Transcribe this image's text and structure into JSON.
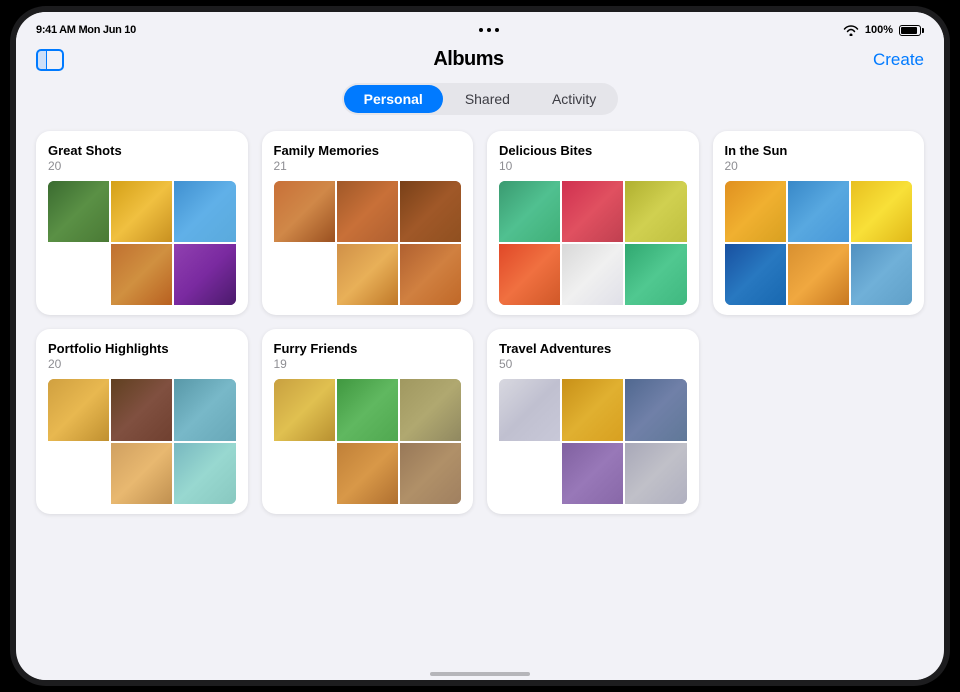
{
  "statusBar": {
    "time": "9:41 AM",
    "date": "Mon Jun 10",
    "battery": "100%"
  },
  "nav": {
    "title": "Albums",
    "createBtn": "Create"
  },
  "tabs": [
    {
      "id": "personal",
      "label": "Personal",
      "active": true
    },
    {
      "id": "shared",
      "label": "Shared",
      "active": false
    },
    {
      "id": "activity",
      "label": "Activity",
      "active": false
    }
  ],
  "albums": [
    {
      "title": "Great Shots",
      "count": "20",
      "photos": [
        "p-green p-person-green",
        "p-yellow",
        "p-blue p-sky-blue",
        "p-warmth",
        "p-purple",
        "p-sky-blue"
      ]
    },
    {
      "title": "Family Memories",
      "count": "21",
      "photos": [
        "p-faces1",
        "p-faces2",
        "p-faces3",
        "p-faces4",
        "p-faces1",
        "p-faces2"
      ]
    },
    {
      "title": "Delicious Bites",
      "count": "10",
      "photos": [
        "p-food1",
        "p-food2",
        "p-food3",
        "p-food4",
        "p-food5",
        "p-food6"
      ]
    },
    {
      "title": "In the Sun",
      "count": "20",
      "photos": [
        "p-sun1",
        "p-sun2",
        "p-sun3",
        "p-sun4",
        "p-sun5",
        "p-sun6"
      ]
    },
    {
      "title": "Portfolio Highlights",
      "count": "20",
      "photos": [
        "p-port1",
        "p-port2",
        "p-port3",
        "p-port4",
        "p-port5",
        "p-port6"
      ]
    },
    {
      "title": "Furry Friends",
      "count": "19",
      "photos": [
        "p-dog1",
        "p-dog2",
        "p-dog3",
        "p-dog4",
        "p-dog5",
        "p-dog6"
      ]
    },
    {
      "title": "Travel Adventures",
      "count": "50",
      "photos": [
        "p-trav1",
        "p-trav2",
        "p-trav3",
        "p-trav4",
        "p-trav5",
        "p-trav6"
      ]
    }
  ]
}
